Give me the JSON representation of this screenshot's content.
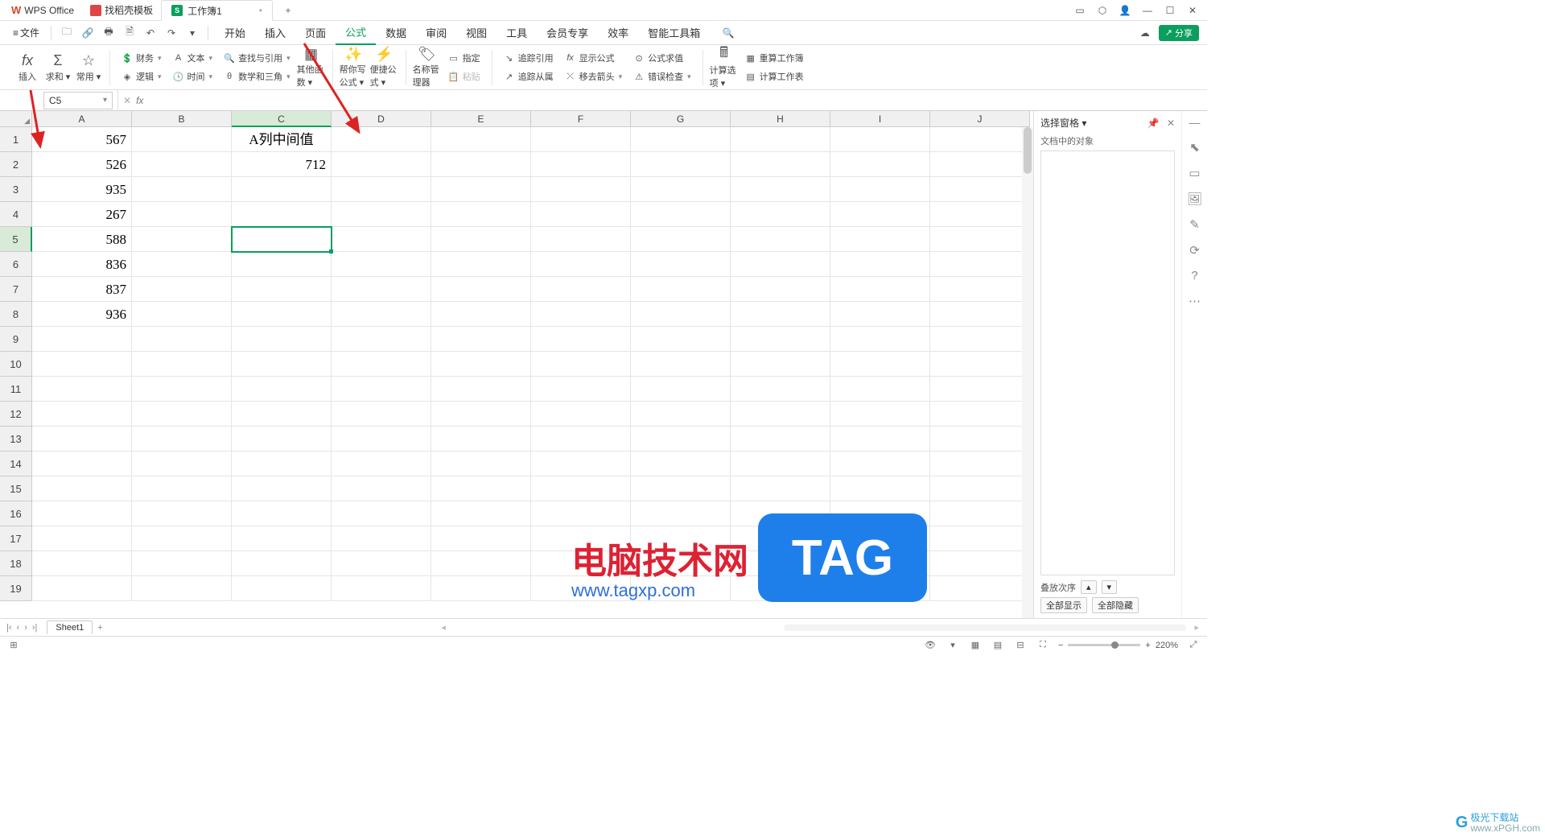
{
  "titlebar": {
    "app_name": "WPS Office",
    "template_tab": "找稻壳模板",
    "doc_badge": "S",
    "doc_name": "工作簿1",
    "add": "+"
  },
  "menubar": {
    "file": "文件",
    "items": [
      "开始",
      "插入",
      "页面",
      "公式",
      "数据",
      "审阅",
      "视图",
      "工具",
      "会员专享",
      "效率",
      "智能工具箱"
    ],
    "active_index": 3,
    "share": "分享"
  },
  "ribbon": {
    "big": {
      "insert": "插入",
      "sum": "求和",
      "common": "常用"
    },
    "col1": {
      "finance": "财务",
      "logic": "逻辑",
      "text": "文本",
      "time": "时间",
      "lookup": "查找与引用",
      "math": "数学和三角"
    },
    "other": "其他函数",
    "help": "帮你写公式",
    "conv": "便捷公式",
    "name_mgr": "名称管理器",
    "assign": "指定",
    "paste": "粘贴",
    "trace_ref": "追踪引用",
    "trace_dep": "追踪从属",
    "show_formula": "显示公式",
    "remove_arrow": "移去箭头",
    "eval": "公式求值",
    "err_check": "错误检查",
    "calc_opt": "计算选项",
    "recalc_book": "重算工作簿",
    "calc_sheet": "计算工作表"
  },
  "formula_bar": {
    "cell_ref": "C5",
    "fx": "fx"
  },
  "grid": {
    "columns": [
      "A",
      "B",
      "C",
      "D",
      "E",
      "F",
      "G",
      "H",
      "I",
      "J"
    ],
    "sel_col_index": 2,
    "sel_row_index": 4,
    "rows": 19,
    "data": {
      "A1": "567",
      "A2": "526",
      "A3": "935",
      "A4": "267",
      "A5": "588",
      "A6": "836",
      "A7": "837",
      "A8": "936",
      "C1": "A列中间值",
      "C2": "712"
    },
    "selected": "C5"
  },
  "right_panel": {
    "title": "选择窗格",
    "objects_label": "文档中的对象",
    "stack_order": "叠放次序",
    "show_all": "全部显示",
    "hide_all": "全部隐藏"
  },
  "sheettabs": {
    "sheet1": "Sheet1"
  },
  "statusbar": {
    "mode_icon": "◫",
    "zoom": "220%"
  },
  "watermark": {
    "text": "电脑技术网",
    "url": "www.tagxp.com",
    "tag": "TAG",
    "site2": "极光下载站",
    "site2url": "www.xPGH.com"
  }
}
